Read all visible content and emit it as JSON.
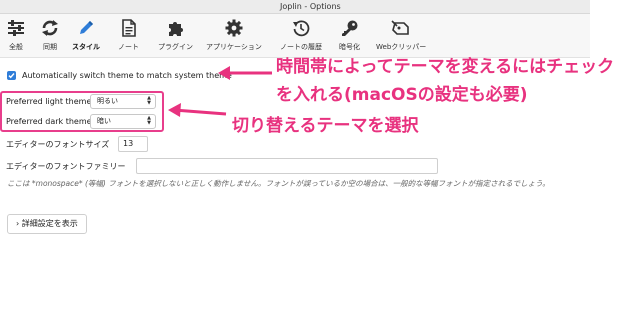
{
  "window": {
    "title": "Joplin - Options"
  },
  "toolbar": {
    "items": [
      {
        "label": "全般",
        "icon": "sliders-icon"
      },
      {
        "label": "同期",
        "icon": "sync-icon"
      },
      {
        "label": "スタイル",
        "icon": "pen-icon",
        "active": true
      },
      {
        "label": "ノート",
        "icon": "note-icon"
      },
      {
        "label": "プラグイン",
        "icon": "puzzle-icon"
      },
      {
        "label": "アプリケーション",
        "icon": "gear-icon"
      },
      {
        "label": "ノートの履歴",
        "icon": "history-icon"
      },
      {
        "label": "暗号化",
        "icon": "key-icon"
      },
      {
        "label": "Webクリッパー",
        "icon": "clipper-icon"
      }
    ]
  },
  "settings": {
    "auto_switch": {
      "label": "Automatically switch theme to match system theme",
      "checked": true
    },
    "light_theme": {
      "label": "Preferred light theme",
      "value": "明るい"
    },
    "dark_theme": {
      "label": "Preferred dark theme",
      "value": "暗い"
    },
    "font_size": {
      "label": "エディターのフォントサイズ",
      "value": "13"
    },
    "font_family": {
      "label": "エディターのフォントファミリー",
      "value": ""
    },
    "note": "ここは *monospace* (等幅) フォントを選択しないと正しく動作しません。フォントが誤っているか空の場合は、一般的な等幅フォントが指定されるでしょう。",
    "advanced_button": "詳細設定を表示"
  },
  "annotations": {
    "line1": "時間帯によってテーマを変えるにはチェック",
    "line2": "を入れる(macOSの設定も必要)",
    "line3": "切り替えるテーマを選択",
    "color": "#e8327f"
  },
  "colors": {
    "accent": "#2f7dd8",
    "annotation": "#e8327f"
  }
}
